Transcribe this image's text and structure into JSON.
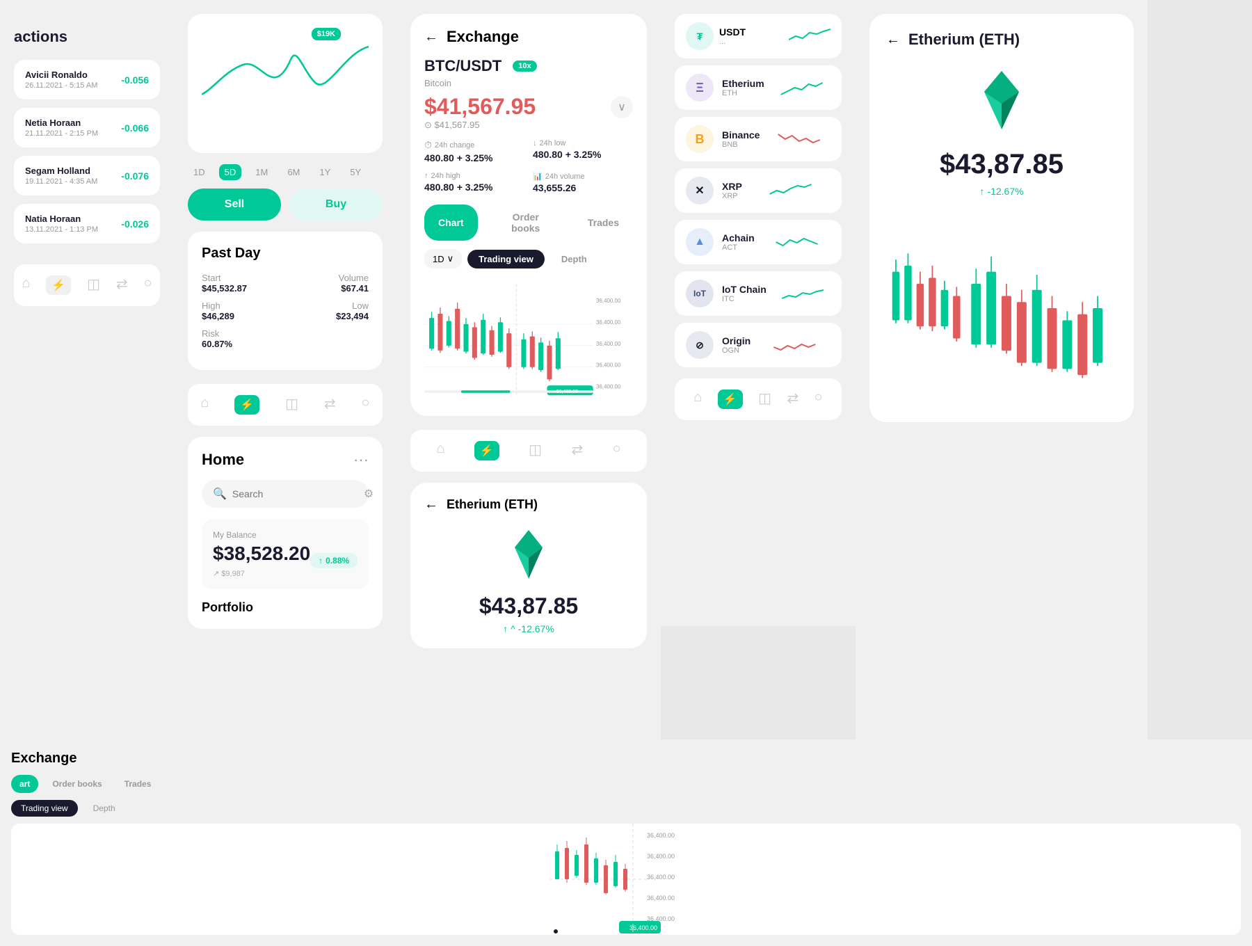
{
  "transactions": {
    "title": "actions",
    "items": [
      {
        "name": "Avicii Ronaldo",
        "date": "26.11.2021 - 5:15 AM",
        "amount": "-0.056"
      },
      {
        "name": "Netia Horaan",
        "date": "21.11.2021 - 2:15 PM",
        "amount": "-0.066"
      },
      {
        "name": "Segam Holland",
        "date": "19.11.2021 - 4:35 AM",
        "amount": "-0.076"
      },
      {
        "name": "Natia Horaan",
        "date": "13.11.2021 - 1:13 PM",
        "amount": "-0.026"
      }
    ]
  },
  "chart": {
    "price_badge": "$19K",
    "time_filters": [
      "1D",
      "5D",
      "1M",
      "6M",
      "1Y",
      "5Y"
    ],
    "active_filter": "5D",
    "sell_label": "Sell",
    "buy_label": "Buy"
  },
  "past_day": {
    "title": "Past Day",
    "start_label": "Start",
    "start_value": "$45,532.87",
    "volume_label": "Volume",
    "volume_value": "$67.41",
    "high_label": "High",
    "high_value": "$46,289",
    "low_label": "Low",
    "low_value": "$23,494",
    "risk_label": "Risk",
    "risk_value": "60.87%"
  },
  "home": {
    "title": "Home",
    "search_placeholder": "Search",
    "balance_label": "My Balance",
    "balance_amount": "$38,528.20",
    "balance_change": "0.88%",
    "balance_sub": "$9,987",
    "portfolio_title": "Portfolio",
    "menu_dots": "···"
  },
  "exchange": {
    "title": "Exchange",
    "pair": "BTC/USDT",
    "leverage": "10x",
    "coin_name": "Bitcoin",
    "price": "$41,567.95",
    "price_sub": "⊙ $41,567.95",
    "change_24h_label": "24h change",
    "change_24h_value": "480.80 + 3.25%",
    "low_24h_label": "24h low",
    "low_24h_value": "480.80 + 3.25%",
    "high_24h_label": "24h high",
    "high_24h_value": "480.80 + 3.25%",
    "volume_24h_label": "24h volume",
    "volume_24h_value": "43,655.26",
    "tab_chart": "Chart",
    "tab_order_books": "Order books",
    "tab_trades": "Trades",
    "period": "1D",
    "view_trading": "Trading view",
    "view_depth": "Depth",
    "price_levels": [
      "36,400.00",
      "36,400.00",
      "36,400.00",
      "36,400.00",
      "36,400.00"
    ]
  },
  "exchange_partial": {
    "title": "Exchange",
    "tab_chart": "art",
    "tab_order": "Order books",
    "tab_trades": "Trades",
    "view_trading": "Trading view",
    "view_depth": "Depth"
  },
  "crypto_list": {
    "items": [
      {
        "name": "Etherium",
        "symbol": "ETH",
        "color": "#7c5cbf",
        "bg": "#ede8f7"
      },
      {
        "name": "Binance",
        "symbol": "BNB",
        "color": "#f3a117",
        "bg": "#fef5e0"
      },
      {
        "name": "XRP",
        "symbol": "XRP",
        "color": "#1a1a2e",
        "bg": "#e8e8f0"
      },
      {
        "name": "Achain",
        "symbol": "ACT",
        "color": "#5c8fd6",
        "bg": "#e5eef9"
      },
      {
        "name": "IoT Chain",
        "symbol": "ITC",
        "color": "#3a4a6b",
        "bg": "#e2e5f0"
      },
      {
        "name": "Origin",
        "symbol": "OGN",
        "color": "#1a1a2e",
        "bg": "#e8e8f0"
      }
    ]
  },
  "eth_detail": {
    "title": "Etherium (ETH)",
    "price": "$43,87.85",
    "change": "-12.67%",
    "eth_title_center": "Etherium (ETH)",
    "eth_price_center": "$43,87.85",
    "eth_change_center": "^ -12.67%"
  },
  "nav": {
    "home": "⌂",
    "lightning": "⚡",
    "wallet": "◫",
    "exchange": "⇄",
    "profile": "○"
  }
}
